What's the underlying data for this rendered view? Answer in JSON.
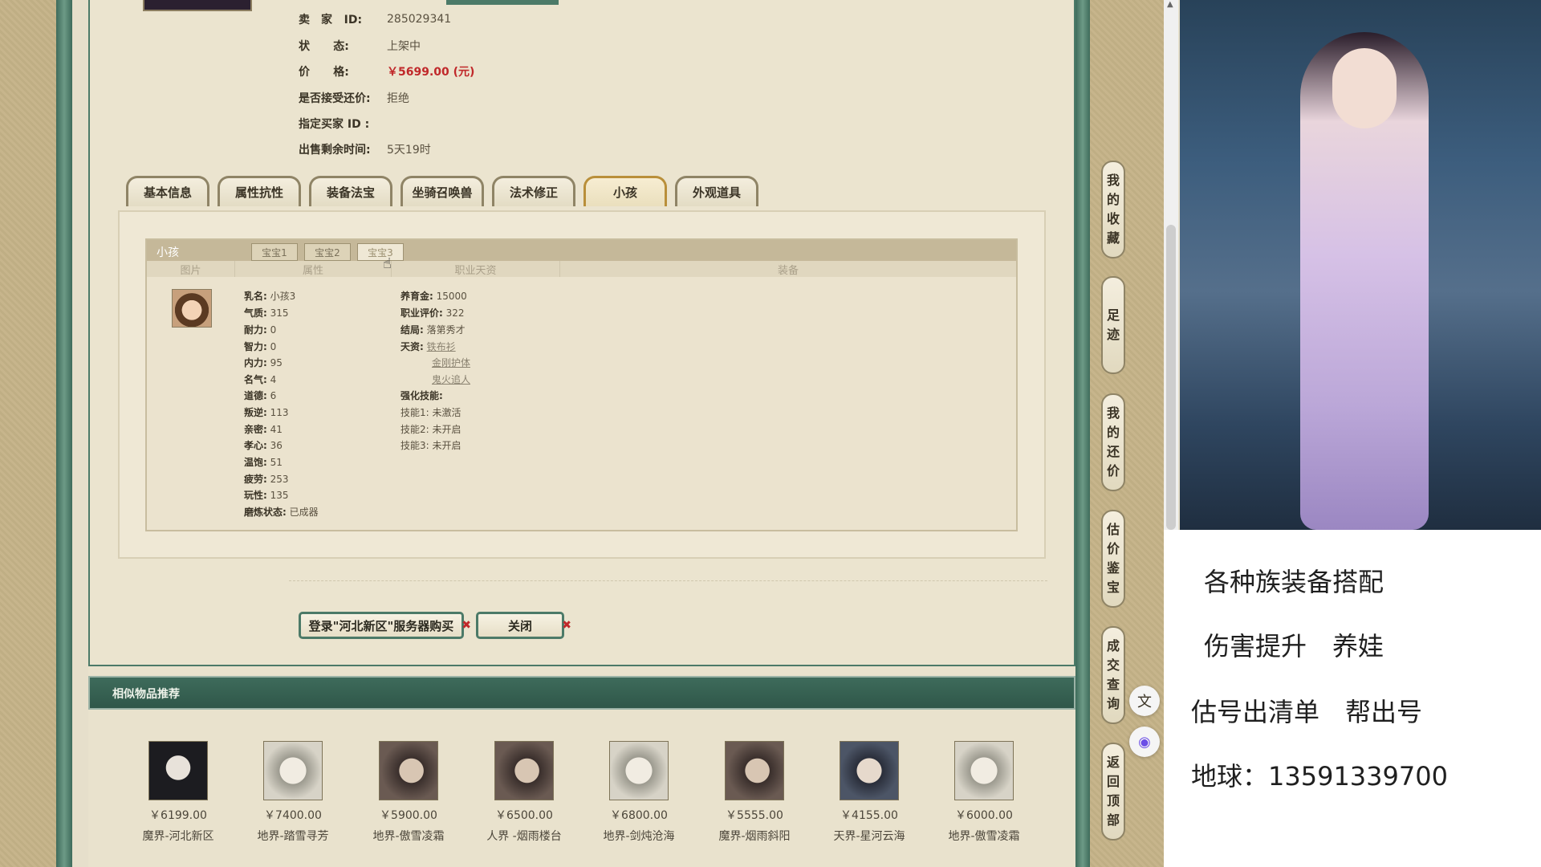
{
  "seller": {
    "rows": [
      {
        "label": "卖　家",
        "sub": "ID:",
        "value": "285029341"
      },
      {
        "label": "状",
        "sub": "态:",
        "value": "上架中"
      },
      {
        "label": "价",
        "sub": "格:",
        "value": "￥5699.00 (元)"
      },
      {
        "label": "是否接受还价:",
        "value": "拒绝"
      },
      {
        "label": "指定买家 ID :",
        "value": ""
      },
      {
        "label": "出售剩余时间:",
        "value": "5天19时"
      }
    ]
  },
  "tabs": [
    "基本信息",
    "属性抗性",
    "装备法宝",
    "坐骑召唤兽",
    "法术修正",
    "小孩",
    "外观道具"
  ],
  "active_tab": "小孩",
  "child": {
    "title": "小孩",
    "subtabs": [
      "宝宝1",
      "宝宝2",
      "宝宝3"
    ],
    "columns": [
      "图片",
      "属性",
      "职业天资",
      "装备"
    ],
    "attrs": [
      {
        "k": "乳名:",
        "v": "小孩3"
      },
      {
        "k": "气质:",
        "v": "315"
      },
      {
        "k": "耐力:",
        "v": "0"
      },
      {
        "k": "智力:",
        "v": "0"
      },
      {
        "k": "内力:",
        "v": "95"
      },
      {
        "k": "名气:",
        "v": "4"
      },
      {
        "k": "道德:",
        "v": "6"
      },
      {
        "k": "叛逆:",
        "v": "113"
      },
      {
        "k": "亲密:",
        "v": "41"
      },
      {
        "k": "孝心:",
        "v": "36"
      },
      {
        "k": "温饱:",
        "v": "51"
      },
      {
        "k": "疲劳:",
        "v": "253"
      },
      {
        "k": "玩性:",
        "v": "135"
      },
      {
        "k": "磨炼状态:",
        "v": "已成器"
      }
    ],
    "career": {
      "fund_k": "养育金:",
      "fund_v": "15000",
      "rating_k": "职业评价:",
      "rating_v": "322",
      "ending_k": "结局:",
      "ending_v": "落第秀才",
      "talent_k": "天资:",
      "talents": [
        "铁布衫",
        "金刚护体",
        "鬼火追人"
      ],
      "skill_title": "强化技能:",
      "skills": [
        {
          "k": "技能1:",
          "v": "未激活"
        },
        {
          "k": "技能2:",
          "v": "未开启"
        },
        {
          "k": "技能3:",
          "v": "未开启"
        }
      ]
    }
  },
  "buttons": {
    "login": "登录\"河北新区\"服务器购买",
    "close": "关闭"
  },
  "recommend": {
    "title": "相似物品推荐",
    "items": [
      {
        "price": "￥6199.00",
        "server": "魔界-河北新区",
        "face": "dark"
      },
      {
        "price": "￥7400.00",
        "server": "地界-踏雪寻芳",
        "face": "pale"
      },
      {
        "price": "￥5900.00",
        "server": "地界-傲雪凌霜",
        "face": "brown"
      },
      {
        "price": "￥6500.00",
        "server": "人界 -烟雨楼台",
        "face": "brown"
      },
      {
        "price": "￥6800.00",
        "server": "地界-剑炖沧海",
        "face": "pale"
      },
      {
        "price": "￥5555.00",
        "server": "魔界-烟雨斜阳",
        "face": "brown"
      },
      {
        "price": "￥4155.00",
        "server": "天界-星河云海",
        "face": "man"
      },
      {
        "price": "￥6000.00",
        "server": "地界-傲雪凌霜",
        "face": "pale"
      }
    ]
  },
  "side_nav": [
    {
      "label": "我的收藏",
      "chars": [
        "我",
        "的",
        "收",
        "藏"
      ]
    },
    {
      "label": "足迹",
      "chars": [
        "足",
        "迹"
      ]
    },
    {
      "label": "我的还价",
      "chars": [
        "我",
        "的",
        "还",
        "价"
      ]
    },
    {
      "label": "估价鉴宝",
      "chars": [
        "估",
        "价",
        "鉴",
        "宝"
      ]
    },
    {
      "label": "成交查询",
      "chars": [
        "成",
        "交",
        "查",
        "询"
      ]
    },
    {
      "label": "返回顶部",
      "chars": [
        "返",
        "回",
        "顶",
        "部"
      ]
    }
  ],
  "promo": {
    "lines": [
      "各种族装备搭配",
      "伤害提升　养娃",
      "估号出清单　帮出号",
      "地球：13591339700"
    ]
  },
  "colors": {
    "accent_green": "#3e6b5b",
    "price_red": "#c0282a",
    "tab_gold": "#b98f3a"
  }
}
